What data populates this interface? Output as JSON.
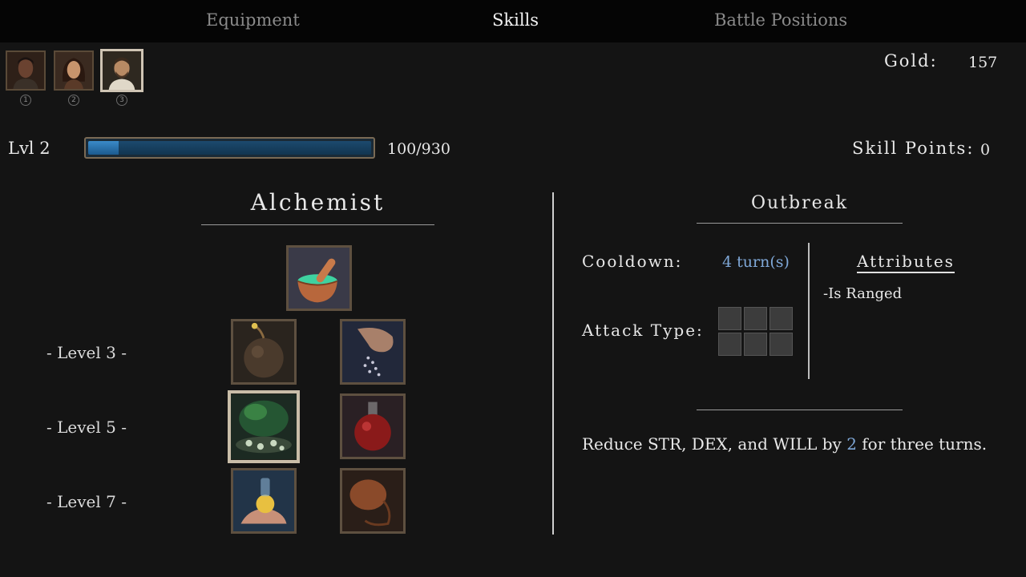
{
  "tabs": [
    {
      "label": "Equipment",
      "active": false
    },
    {
      "label": "Skills",
      "active": true
    },
    {
      "label": "Battle Positions",
      "active": false
    }
  ],
  "party": [
    {
      "number": "1",
      "selected": false
    },
    {
      "number": "2",
      "selected": false
    },
    {
      "number": "3",
      "selected": true
    }
  ],
  "gold": {
    "label": "Gold:",
    "value": "157"
  },
  "level": {
    "label": "Lvl 2",
    "xp_text": "100/930",
    "xp_fraction": 0.107
  },
  "skill_points": {
    "label": "Skill Points:",
    "value": "0"
  },
  "class_name": "Alchemist",
  "tree": {
    "root_icon": "mortar-pestle-icon",
    "rows": [
      {
        "label": "- Level 3 -",
        "skills": [
          "bomb-icon",
          "scatter-powder-icon"
        ]
      },
      {
        "label": "- Level 5 -",
        "skills": [
          "poison-cloud-icon",
          "red-potion-icon"
        ]
      },
      {
        "label": "- Level 7 -",
        "skills": [
          "glowing-vial-hand-icon",
          "bellows-icon"
        ]
      }
    ],
    "selected": "poison-cloud-icon"
  },
  "detail": {
    "title": "Outbreak",
    "cooldown_label": "Cooldown:",
    "cooldown_value": "4 turn(s)",
    "attack_type_label": "Attack Type:",
    "attributes_title": "Attributes",
    "attributes": [
      "-Is Ranged"
    ],
    "description_pre": "Reduce STR, DEX, and WILL by ",
    "description_num": "2",
    "description_post": " for three turns."
  },
  "colors": {
    "accent_blue": "#7fa8d8",
    "xp_fill": "#2a78b8",
    "frame": "#5e5040"
  }
}
